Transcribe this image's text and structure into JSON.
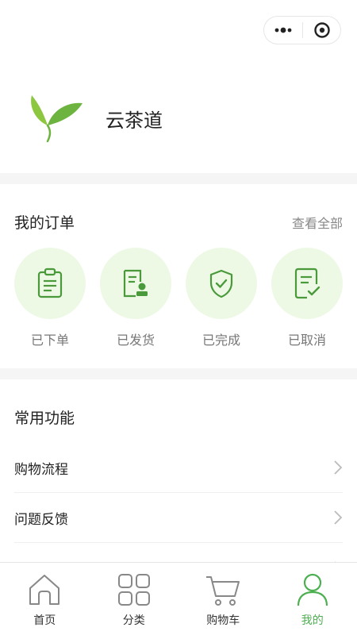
{
  "app": {
    "name": "云茶道"
  },
  "colors": {
    "accent": "#4caf50",
    "order_circle_bg": "#edf9e5"
  },
  "orders": {
    "title": "我的订单",
    "view_all": "查看全部",
    "items": [
      {
        "label": "已下单",
        "icon": "clipboard-icon"
      },
      {
        "label": "已发货",
        "icon": "document-stamp-icon"
      },
      {
        "label": "已完成",
        "icon": "shield-check-icon"
      },
      {
        "label": "已取消",
        "icon": "document-check-icon"
      }
    ]
  },
  "functions": {
    "title": "常用功能",
    "items": [
      {
        "label": "购物流程"
      },
      {
        "label": "问题反馈"
      }
    ]
  },
  "tabbar": {
    "items": [
      {
        "label": "首页",
        "icon": "home-icon",
        "active": false
      },
      {
        "label": "分类",
        "icon": "grid-icon",
        "active": false
      },
      {
        "label": "购物车",
        "icon": "cart-icon",
        "active": false
      },
      {
        "label": "我的",
        "icon": "person-icon",
        "active": true
      }
    ]
  }
}
